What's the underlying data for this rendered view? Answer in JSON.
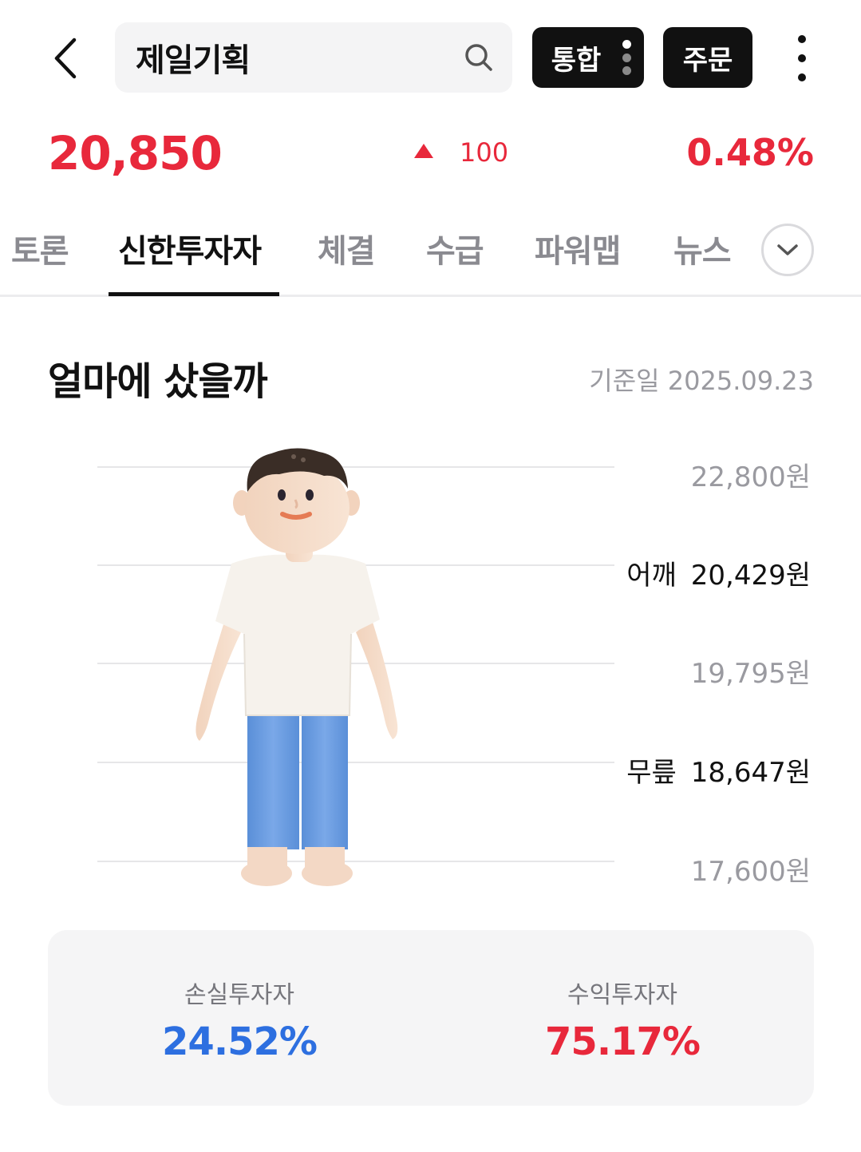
{
  "header": {
    "search_text": "제일기획",
    "integrated_label": "통합",
    "order_label": "주문"
  },
  "quote": {
    "price": "20,850",
    "change": "100",
    "change_percent": "0.48%",
    "direction": "up",
    "up_color": "#e8283b"
  },
  "tabs": [
    {
      "label": "토론"
    },
    {
      "label": "신한투자자"
    },
    {
      "label": "체결"
    },
    {
      "label": "수급"
    },
    {
      "label": "파워맵"
    },
    {
      "label": "뉴스"
    }
  ],
  "active_tab": "신한투자자",
  "section": {
    "title": "얼마에 샀을까",
    "base_date": "기준일 2025.09.23"
  },
  "levels": [
    {
      "label": "",
      "price": "22,800원"
    },
    {
      "label": "어깨",
      "price": "20,429원"
    },
    {
      "label": "",
      "price": "19,795원"
    },
    {
      "label": "무릎",
      "price": "18,647원"
    },
    {
      "label": "",
      "price": "17,600원"
    }
  ],
  "summary": {
    "loss_label": "손실투자자",
    "loss_value": "24.52%",
    "loss_color": "#2d6fe0",
    "profit_label": "수익투자자",
    "profit_value": "75.17%",
    "profit_color": "#e8283b"
  }
}
